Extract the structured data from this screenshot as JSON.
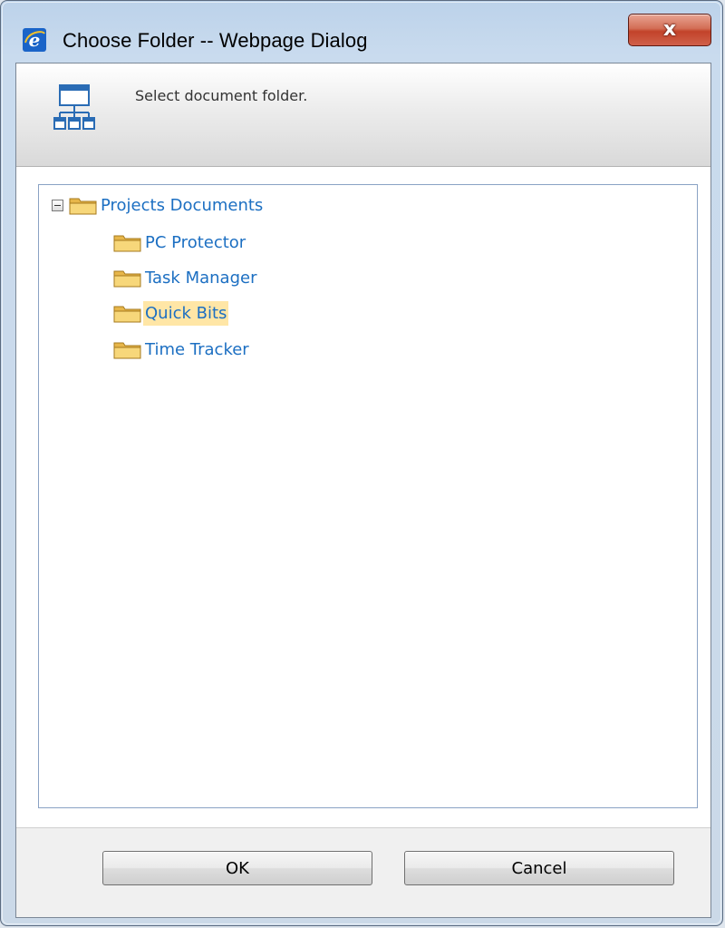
{
  "window": {
    "title": "Choose Folder -- Webpage Dialog",
    "close_label": "x"
  },
  "header": {
    "instruction": "Select document folder."
  },
  "tree": {
    "root": {
      "label": "Projects Documents",
      "expanded": true,
      "children": [
        {
          "label": "PC Protector",
          "selected": false
        },
        {
          "label": "Task Manager",
          "selected": false
        },
        {
          "label": "Quick Bits",
          "selected": true
        },
        {
          "label": "Time Tracker",
          "selected": false
        }
      ]
    }
  },
  "buttons": {
    "ok_label": "OK",
    "cancel_label": "Cancel"
  },
  "colors": {
    "link_text": "#1c6fc2",
    "selection_highlight": "#ffe6a6",
    "close_button_red": "#c2432a"
  },
  "icons": {
    "title": "internet-explorer-icon",
    "header": "site-hierarchy-icon",
    "tree_node": "folder-icon",
    "tree_expander": "collapse-minus-icon"
  }
}
